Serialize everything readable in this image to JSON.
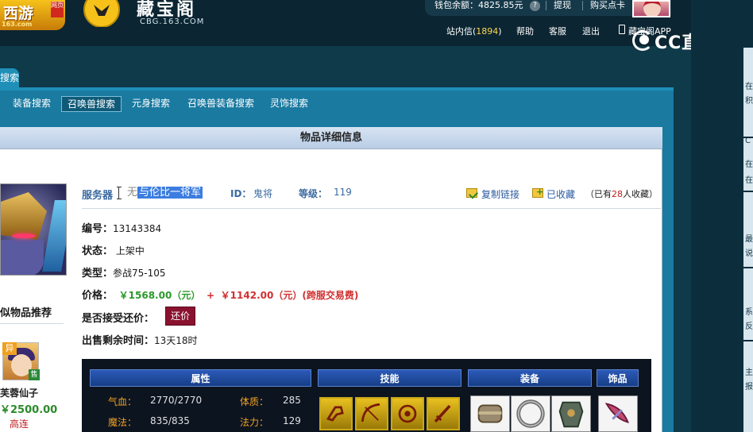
{
  "header": {
    "logo_word": "西游",
    "logo_tag": "网页",
    "logo_domain": "163.com",
    "cbg_title": "藏宝阁",
    "cbg_sub": "CBG.163.COM",
    "wallet_label": "钱包余额：4825.85元",
    "help_mark": "?",
    "withdraw": "提现",
    "buy_card": "购买点卡",
    "messages_label": "站内信",
    "messages_count": "1894",
    "help": "帮助",
    "service": "客服",
    "logout": "退出",
    "app": "藏宝阁APP",
    "watermark": "CC直播"
  },
  "search": {
    "active_tab": "搜索",
    "subnav": [
      "装备搜索",
      "召唤兽搜索",
      "元身搜索",
      "召唤兽装备搜索",
      "灵饰搜索"
    ],
    "subnav_active": 1
  },
  "detail": {
    "title": "物品详细信息",
    "server_label": "服务器",
    "server_value_pre": "无",
    "server_value_hl": "与伦比一将军",
    "id_label": "ID：",
    "id_value": "鬼将",
    "level_label": "等级：",
    "level_value": "119",
    "copy_link": "复制链接",
    "fav_link": "已收藏",
    "fav_count_pre": "（已有",
    "fav_count_num": "28",
    "fav_count_post": "人收藏）",
    "code_label": "编号：",
    "code_value": "13143384",
    "status_label": "状态：",
    "status_value": "上架中",
    "type_label": "类型：",
    "type_value": "参战75-105",
    "price_label": "价格：",
    "price_main": "￥1568.00（元）",
    "price_plus": "+",
    "price_fee": "￥1142.00（元）(跨服交易费)",
    "counter_label": "是否接受还价：",
    "counter_button": "还价",
    "remain_label": "出售剩余时间：",
    "remain_value": "13天18时"
  },
  "similar": {
    "title": "似物品推荐",
    "tag_yi": "异",
    "tag_shou": "售",
    "pet_name": "芙蓉仙子",
    "pet_price": "2500.00",
    "pet_speed": "高连"
  },
  "attrs": {
    "head_attr": "属性",
    "head_skill": "技能",
    "head_equip": "装备",
    "head_acc": "饰品",
    "rows": [
      {
        "k1": "气血：",
        "v1": "2770/2770",
        "k2": "体质：",
        "v2": "285"
      },
      {
        "k1": "魔法：",
        "v1": "835/835",
        "k2": "法力：",
        "v2": "129"
      }
    ]
  },
  "right_panel": [
    "在",
    "积",
    "C",
    "在",
    "在",
    "最",
    "说",
    "系",
    "反",
    "主",
    "报"
  ],
  "colors": {
    "accent": "#1a7aa0",
    "price_green": "#2a9a2a",
    "price_red": "#d03030",
    "counter_btn": "#8a1230"
  }
}
